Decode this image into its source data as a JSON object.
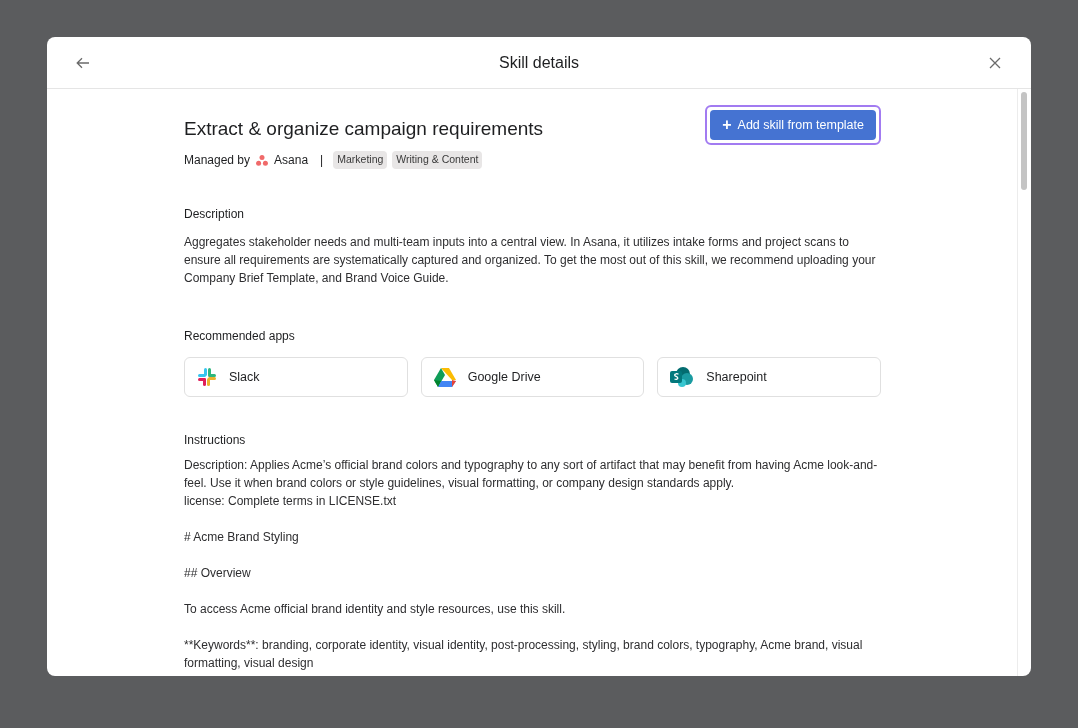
{
  "dialog": {
    "title": "Skill details"
  },
  "skill": {
    "title": "Extract & organize campaign requirements",
    "managed_by_label": "Managed by",
    "owner": "Asana",
    "separator": "|",
    "tags": [
      "Marketing",
      "Writing & Content"
    ]
  },
  "primary_button": {
    "icon": "+",
    "label": "Add skill from template",
    "focused": true
  },
  "description": {
    "heading": "Description",
    "text": "Aggregates stakeholder needs and multi-team inputs into a central view. In Asana, it utilizes intake forms and project scans to ensure all requirements are systematically captured and organized. To get the most out of this skill, we recommend uploading your Company Brief Template, and Brand Voice Guide."
  },
  "recommended_apps": {
    "heading": "Recommended apps",
    "apps": [
      {
        "name": "Slack",
        "kind": "slack"
      },
      {
        "name": "Google Drive",
        "kind": "drive"
      },
      {
        "name": "Sharepoint",
        "kind": "sharepoint"
      }
    ]
  },
  "instructions": {
    "heading": "Instructions",
    "paragraphs": [
      [
        "Description: Applies Acme’s official brand colors and typography to any sort of artifact that may benefit from having Acme look-and-feel. Use it when brand colors or style guidelines, visual formatting, or company design standards apply.",
        "license: Complete terms in LICENSE.txt"
      ],
      [
        "# Acme Brand Styling"
      ],
      [
        "## Overview"
      ],
      [
        "To access Acme official brand identity and style resources, use this skill."
      ],
      [
        "**Keywords**: branding, corporate identity, visual identity, post-processing, styling, brand colors, typography, Acme brand, visual formatting, visual design"
      ]
    ]
  }
}
